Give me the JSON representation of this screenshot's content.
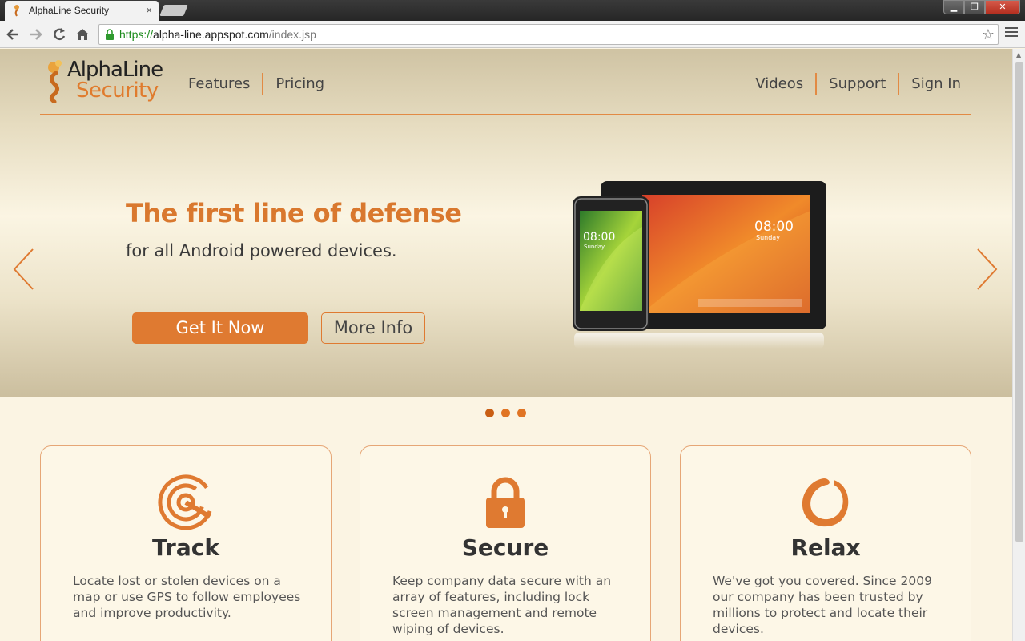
{
  "browser": {
    "tab_title": "AlphaLine Security",
    "tab_close": "×",
    "url": {
      "scheme": "https://",
      "host": "alpha-line.appspot.com",
      "path": "/index.jsp"
    },
    "window_buttons": {
      "minimize": "▁",
      "maximize": "❐",
      "close": "✕"
    }
  },
  "site": {
    "logo": {
      "line1": "AlphaLine",
      "line2": "Security"
    },
    "nav_left": [
      "Features",
      "Pricing"
    ],
    "nav_right": [
      "Videos",
      "Support",
      "Sign In"
    ]
  },
  "hero": {
    "title": "The first line of defense",
    "subtitle": "for all Android powered devices.",
    "primary_button": "Get It Now",
    "secondary_button": "More Info",
    "phone_time": "08:00",
    "phone_day": "Sunday",
    "tablet_time": "08:00",
    "tablet_day": "Sunday",
    "slide_count": 3,
    "active_slide": 1
  },
  "features": [
    {
      "icon": "target-icon",
      "title": "Track",
      "text": "Locate lost or stolen devices on a map or use GPS to follow employees and improve productivity."
    },
    {
      "icon": "padlock-icon",
      "title": "Secure",
      "text": "Keep company data secure with an array of features, including lock screen management and remote wiping of devices."
    },
    {
      "icon": "enso-circle-icon",
      "title": "Relax",
      "text": "We've got you covered. Since 2009 our company has been trusted by millions to protect and locate their devices."
    }
  ],
  "colors": {
    "accent": "#df7a31",
    "text": "#333333",
    "background": "#fbf4e3"
  }
}
